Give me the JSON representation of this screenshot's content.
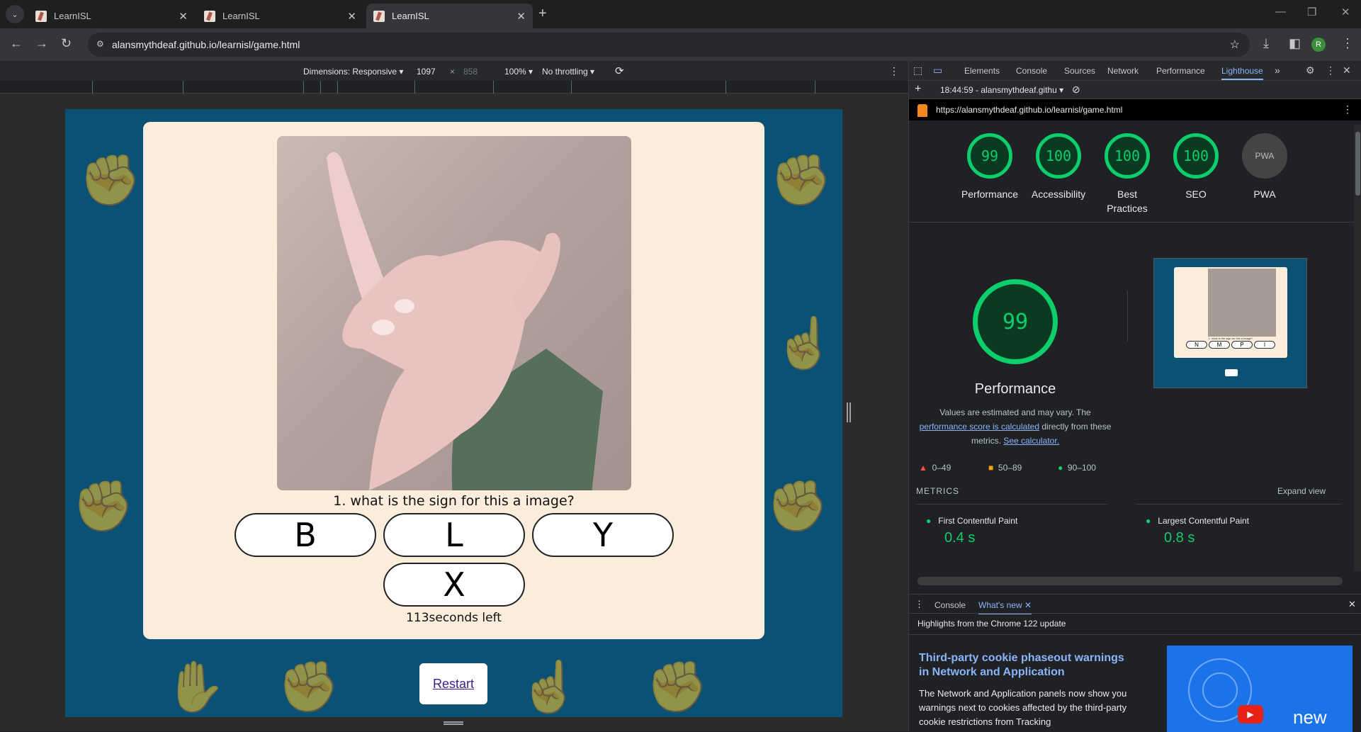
{
  "tabs": [
    {
      "label": "LearnISL"
    },
    {
      "label": "LearnISL"
    },
    {
      "label": "LearnISL"
    }
  ],
  "address": {
    "url": "alansmythdeaf.github.io/learnisl/game.html"
  },
  "devicebar": {
    "dimensions": "Dimensions: Responsive",
    "width": "1097",
    "times": "×",
    "height": "858",
    "zoom": "100%",
    "throttling": "No throttling"
  },
  "game": {
    "question": "1. what is the sign for this a image?",
    "answers": [
      {
        "label": "B"
      },
      {
        "label": "L"
      },
      {
        "label": "Y"
      },
      {
        "label": "X"
      }
    ],
    "timer": "113seconds left",
    "restart": "Restart"
  },
  "devtools": {
    "tabs": [
      "Elements",
      "Console",
      "Sources",
      "Network",
      "Performance",
      "Lighthouse"
    ],
    "active_tab": "Lighthouse",
    "report_select": "18:44:59 - alansmythdeaf.githu",
    "report_url": "https://alansmythdeaf.github.io/learnisl/game.html",
    "scores": [
      {
        "value": "99",
        "label": "Performance"
      },
      {
        "value": "100",
        "label": "Accessibility"
      },
      {
        "value": "100",
        "label": "Best Practices"
      },
      {
        "value": "100",
        "label": "SEO"
      },
      {
        "value": "PWA",
        "label": "PWA"
      }
    ],
    "perf": {
      "score": "99",
      "title": "Performance",
      "note1": "Values are estimated and may vary. The",
      "link1": "performance score is calculated",
      "note2": "directly from these",
      "note3": "metrics.",
      "link2": "See calculator.",
      "legend": [
        "0–49",
        "50–89",
        "90–100"
      ]
    },
    "thumbnail": {
      "answers": [
        "N",
        "M",
        "P",
        "I"
      ],
      "caption": "1. what is the sign for this a image?"
    },
    "metrics": {
      "heading": "METRICS",
      "expand": "Expand view",
      "items": [
        {
          "label": "First Contentful Paint",
          "value": "0.4 s"
        },
        {
          "label": "Largest Contentful Paint",
          "value": "0.8 s"
        }
      ]
    },
    "drawer": {
      "tabs": [
        "Console",
        "What's new"
      ],
      "active": "What's new",
      "highlights": "Highlights from the Chrome 122 update",
      "headline": "Third-party cookie phaseout warnings in Network and Application",
      "body": "The Network and Application panels now show you warnings next to cookies affected by the third-party cookie restrictions from Tracking",
      "video_text": "new"
    }
  },
  "colors": {
    "accent": "#0cce6b",
    "page_bg": "#0a5174",
    "card_bg": "#fbeddb"
  }
}
